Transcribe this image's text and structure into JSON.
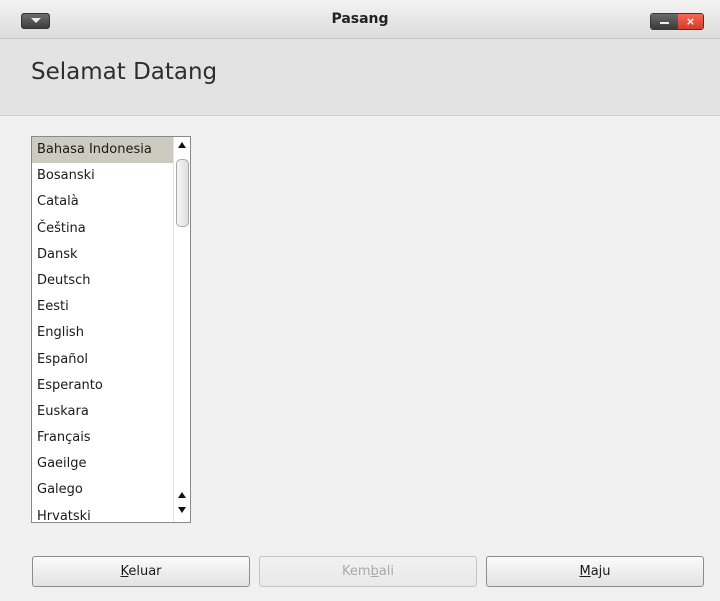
{
  "window": {
    "title": "Pasang",
    "close_glyph": "×"
  },
  "header": {
    "title": "Selamat Datang"
  },
  "language_list": {
    "selected": "Bahasa Indonesia",
    "items": [
      "Bahasa Indonesia",
      "Bosanski",
      "Català",
      "Čeština",
      "Dansk",
      "Deutsch",
      "Eesti",
      "English",
      "Español",
      "Esperanto",
      "Euskara",
      "Français",
      "Gaeilge",
      "Galego",
      "Hrvatski"
    ]
  },
  "buttons": {
    "quit": {
      "mnemonic": "K",
      "rest": "eluar"
    },
    "back": {
      "pre": "Kem",
      "mnemonic": "b",
      "rest": "ali",
      "enabled": false
    },
    "forward": {
      "mnemonic": "M",
      "rest": "aju"
    }
  },
  "icons": {
    "window_menu": "chevron-down-icon",
    "minimize": "minimize-icon",
    "close": "close-icon",
    "scroll_up": "arrow-up-icon",
    "scroll_down": "arrow-down-icon"
  },
  "colors": {
    "selected_row": "#cbcbc0",
    "close_button": "#e04a3a",
    "header_bg": "#e3e3e3"
  }
}
